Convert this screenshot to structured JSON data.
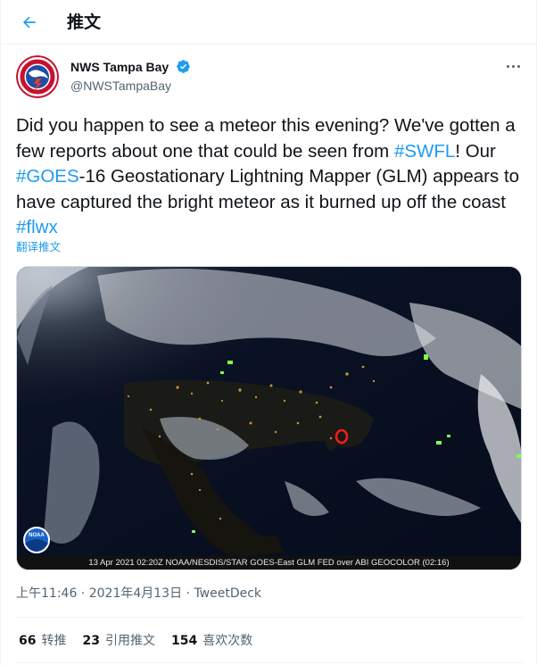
{
  "header": {
    "title": "推文"
  },
  "author": {
    "name": "NWS Tampa Bay",
    "handle": "@NWSTampaBay",
    "avatar_icon": "nws-logo-icon",
    "verified_icon": "verified-badge-icon"
  },
  "tweet": {
    "segments": [
      {
        "text": "Did you happen to see a meteor this evening? We've gotten a few reports about one that could be seen from ",
        "type": "text"
      },
      {
        "text": "#SWFL",
        "type": "hashtag"
      },
      {
        "text": "! Our ",
        "type": "text"
      },
      {
        "text": "#GOES",
        "type": "hashtag"
      },
      {
        "text": "-16 Geostationary Lightning Mapper (GLM) appears to have captured the bright meteor as it burned up off the coast ",
        "type": "text"
      },
      {
        "text": "#flwx",
        "type": "hashtag"
      }
    ],
    "translate_label": "翻译推文"
  },
  "media": {
    "caption": "13 Apr 2021 02:20Z NOAA/NESDIS/STAR GOES-East GLM FED over ABI GEOCOLOR (02:16)",
    "logo_text": "NOAA"
  },
  "meta": {
    "time": "上午11:46",
    "sep": " · ",
    "date": "2021年4月13日",
    "source": "TweetDeck"
  },
  "stats": {
    "retweets_count": "66",
    "retweets_label": "转推",
    "quotes_count": "23",
    "quotes_label": "引用推文",
    "likes_count": "154",
    "likes_label": "喜欢次数"
  },
  "colors": {
    "accent": "#1d9bf0",
    "text": "#0f1419",
    "secondary": "#536471",
    "border": "#eff3f4"
  }
}
